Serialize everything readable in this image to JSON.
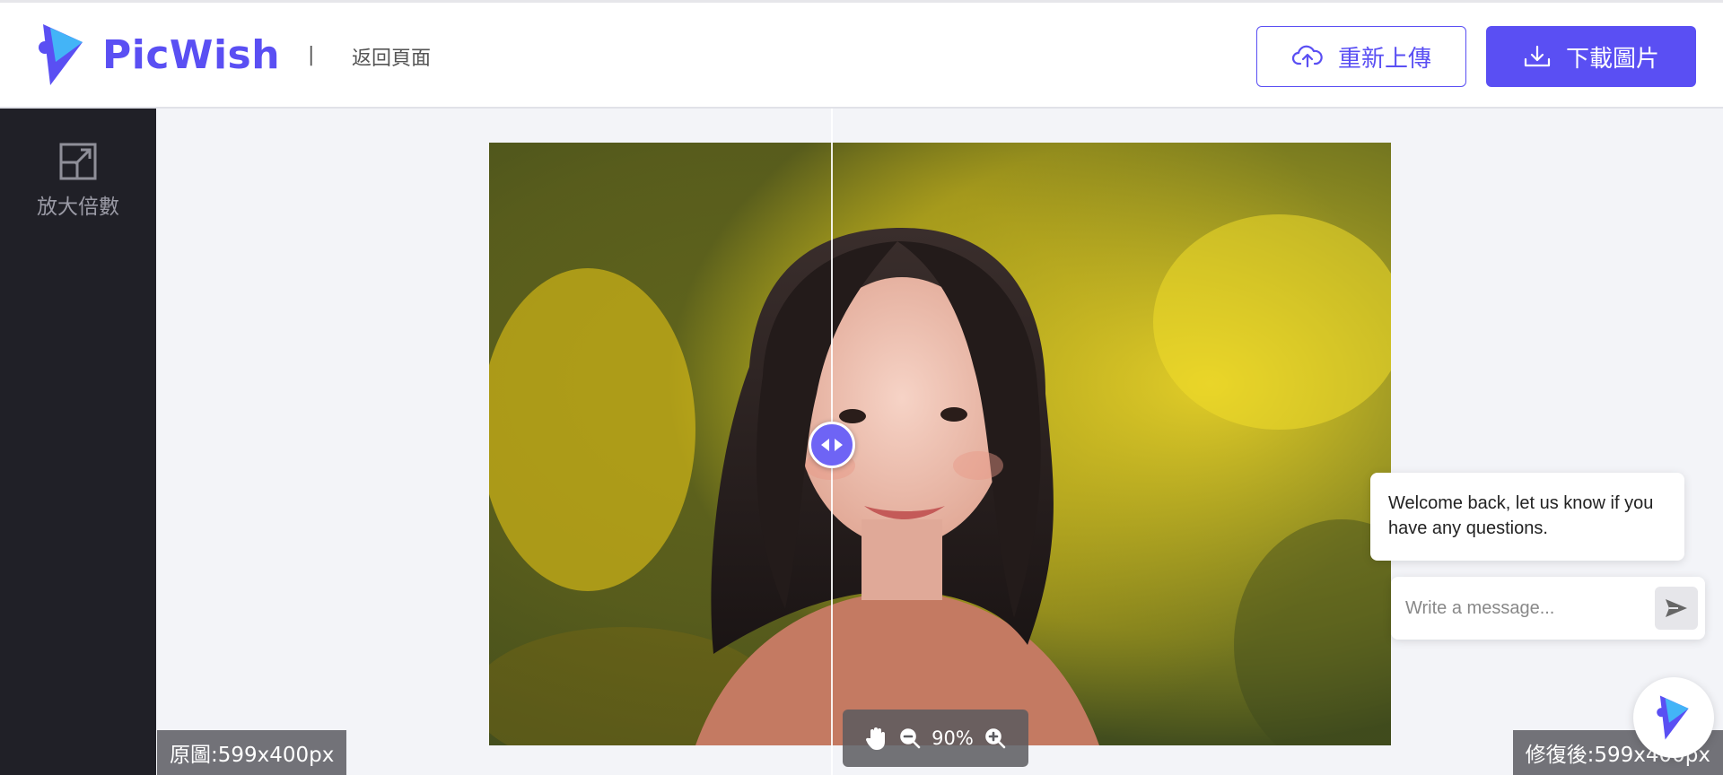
{
  "header": {
    "logo_text": "PicWish",
    "separator": "|",
    "back_label": "返回頁面",
    "reupload_label": "重新上傳",
    "download_label": "下載圖片"
  },
  "sidebar": {
    "tools": [
      {
        "label": "放大倍數",
        "icon": "upscale-icon"
      }
    ]
  },
  "viewer": {
    "zoom_level": "90%",
    "original_label": "原圖:599x400px",
    "fixed_label": "修復後:599x400px",
    "compare_split": 0.38
  },
  "chat": {
    "welcome_message": "Welcome back, let us know if you have any questions.",
    "input_placeholder": "Write a message..."
  },
  "colors": {
    "brand": "#5a4ff3",
    "sidebar_bg": "#202027",
    "canvas_bg": "#f3f4f8"
  }
}
